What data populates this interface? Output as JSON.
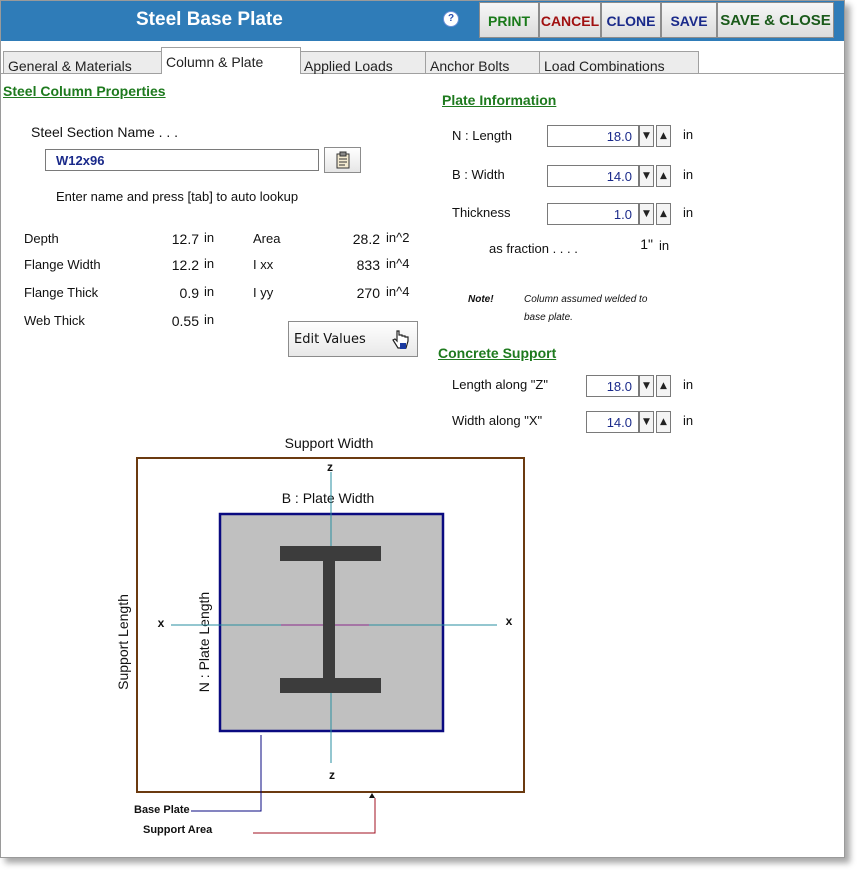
{
  "window": {
    "title": "Steel Base Plate",
    "help_icon": "?",
    "buttons": {
      "print": "PRINT",
      "cancel": "CANCEL",
      "clone": "CLONE",
      "save": "SAVE",
      "save_close": "SAVE & CLOSE"
    }
  },
  "tabs": [
    {
      "label": "General & Materials"
    },
    {
      "label": "Column & Plate"
    },
    {
      "label": "Applied Loads"
    },
    {
      "label": "Anchor Bolts"
    },
    {
      "label": "Load Combinations"
    }
  ],
  "column": {
    "heading": "Steel Column Properties",
    "section_label": "Steel Section Name . . .",
    "section_value": "W12x96",
    "hint": "Enter name and press [tab] to auto lookup",
    "props_left": [
      {
        "label": "Depth",
        "value": "12.7",
        "unit": "in"
      },
      {
        "label": "Flange Width",
        "value": "12.2",
        "unit": "in"
      },
      {
        "label": "Flange Thick",
        "value": "0.9",
        "unit": "in"
      },
      {
        "label": "Web Thick",
        "value": "0.55",
        "unit": "in"
      }
    ],
    "props_right": [
      {
        "label": "Area",
        "value": "28.2",
        "unit": "in^2"
      },
      {
        "label": "I xx",
        "value": "833",
        "unit": "in^4"
      },
      {
        "label": "I yy",
        "value": "270",
        "unit": "in^4"
      }
    ],
    "edit_button": "Edit Values"
  },
  "plate": {
    "heading": "Plate Information",
    "length_label": "N : Length",
    "length_value": "18.0",
    "width_label": "B : Width",
    "width_value": "14.0",
    "thickness_label": "Thickness",
    "thickness_value": "1.0",
    "unit": "in",
    "fraction_label": "as fraction . . . .",
    "fraction_value": "1\"",
    "fraction_unit": "in",
    "note_label": "Note!",
    "note_text_1": "Column assumed welded to",
    "note_text_2": "base plate."
  },
  "concrete": {
    "heading": "Concrete Support",
    "length_label": "Length along \"Z\"",
    "length_value": "18.0",
    "width_label": "Width along \"X\"",
    "width_value": "14.0",
    "unit": "in"
  },
  "diagram": {
    "support_width": "Support Width",
    "support_length": "Support Length",
    "plate_width": "B : Plate Width",
    "plate_length": "N : Plate Length",
    "axis_z": "z",
    "axis_x": "x",
    "base_plate": "Base Plate",
    "support_area": "Support Area"
  },
  "colors": {
    "titlebar": "#2f7cb8",
    "section_heading": "#1e7a1e",
    "support_border": "#6b3a10",
    "plate_border": "#0a0a80",
    "plate_fill": "#c0c0c0",
    "column_fill": "#3c3c3c",
    "axis": "#2a8fa0"
  }
}
